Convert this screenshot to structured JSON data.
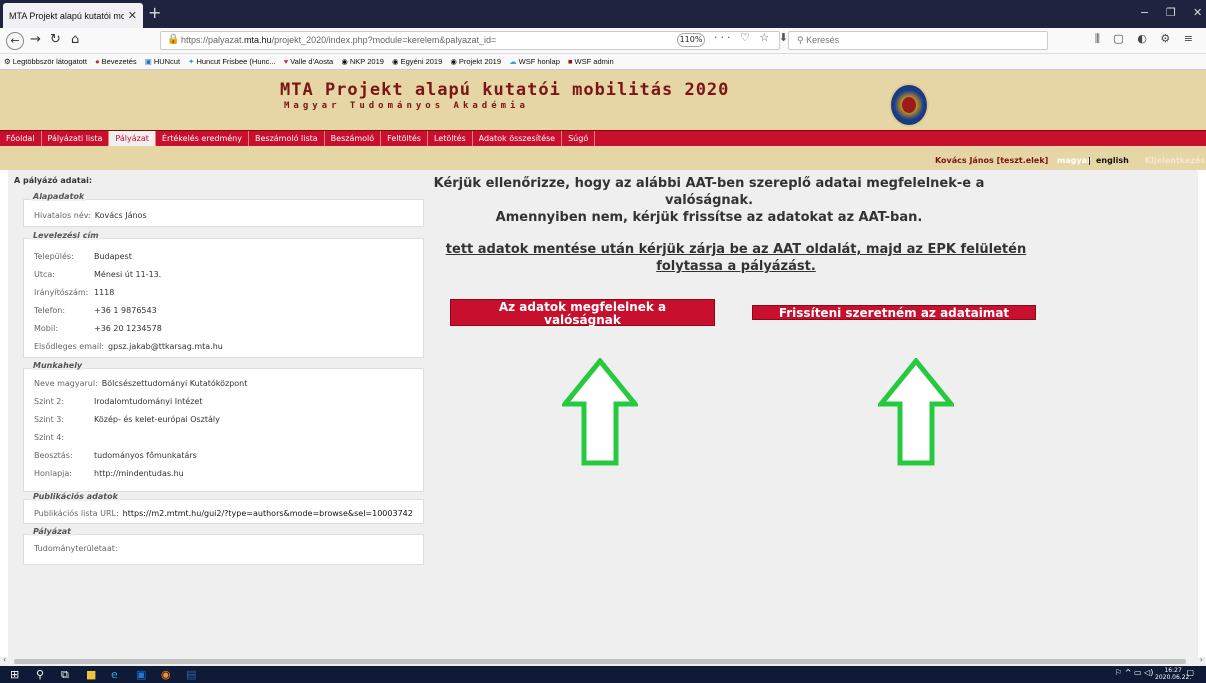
{
  "browser": {
    "tab_title": "MTA Projekt alapú kutatói mobilitá",
    "tab_close": "✕",
    "new_tab": "+",
    "url_prefix": "https://palyazat.",
    "url_domain": "mta.hu",
    "url_rest": "/projekt_2020/index.php?module=kerelem&palyazat_id=",
    "zoom": "110%",
    "search_placeholder": "Keresés",
    "window_minimize": "−",
    "window_restore": "❐",
    "window_close": "✕"
  },
  "bookmarks": [
    {
      "icon": "⚙",
      "label": "Legtöbbször látogatott"
    },
    {
      "icon": "●",
      "label": "Bevezetés"
    },
    {
      "icon": "▣",
      "label": "HUNcut"
    },
    {
      "icon": "✦",
      "label": "Huncut Frisbee (Hunc..."
    },
    {
      "icon": "♥",
      "label": "Valle d'Aosta"
    },
    {
      "icon": "◉",
      "label": "NKP 2019"
    },
    {
      "icon": "◉",
      "label": "Egyéni 2019"
    },
    {
      "icon": "◉",
      "label": "Projekt 2019"
    },
    {
      "icon": "☁",
      "label": "WSF honlap"
    },
    {
      "icon": "■",
      "label": "WSF admin"
    }
  ],
  "site": {
    "title": "MTA Projekt alapú kutatói mobilitás 2020",
    "subtitle": "Magyar Tudományos Akadémia",
    "menu": [
      "Főoldal",
      "Pályázati lista",
      "Pályázat",
      "Értékelés eredmény",
      "Beszámoló lista",
      "Beszámoló",
      "Feltöltés",
      "Letöltés",
      "Adatok összesítése",
      "Súgó"
    ],
    "active_menu_index": 2,
    "user": "Kovács János [teszt.elek]",
    "lang_hu": "magyar",
    "lang_sep": "|",
    "lang_en": "english",
    "logout": "Kijelentkezés"
  },
  "applicant": {
    "heading": "A pályázó adatai:",
    "basics": {
      "title": "Alapadatok",
      "name_label": "Hivatalos név:",
      "name_value": "Kovács János"
    },
    "address": {
      "title": "Levelezési cím",
      "rows": [
        {
          "k": "Település:",
          "v": "Budapest"
        },
        {
          "k": "Utca:",
          "v": "Ménesi út 11-13."
        },
        {
          "k": "Irányítószám:",
          "v": "1118"
        },
        {
          "k": "Telefon:",
          "v": "+36 1 9876543"
        },
        {
          "k": "Mobil:",
          "v": "+36 20 1234578"
        }
      ],
      "email_label": "Elsődleges email:",
      "email_value": "gpsz.jakab@ttkarsag.mta.hu"
    },
    "workplace": {
      "title": "Munkahely",
      "name_label": "Neve magyarul:",
      "name_value": "Bölcsészettudományi Kutatóközpont",
      "rows": [
        {
          "k": "Szint 2:",
          "v": "Irodalomtudományi Intézet"
        },
        {
          "k": "Szint 3:",
          "v": "Közép- és kelet-európai Osztály"
        },
        {
          "k": "Szint 4:",
          "v": ""
        },
        {
          "k": "Beosztás:",
          "v": "tudományos főmunkatárs"
        },
        {
          "k": "Honlapja:",
          "v": "http://mindentudas.hu"
        }
      ]
    },
    "publications": {
      "title": "Publikációs adatok",
      "label": "Publikációs lista URL:",
      "value": "https://m2.mtmt.hu/gui2/?type=authors&mode=browse&sel=10003742"
    },
    "application": {
      "title": "Pályázat",
      "label": "Tudományterületaat:"
    }
  },
  "main": {
    "message_line1": "Kérjük ellenőrizze, hogy az alábbi AAT-ben szereplő adatai megfelelnek-e a",
    "message_line2": "valóságnak.",
    "message_line3": "Amennyiben nem, kérjük frissítse az adatokat az AAT-ban.",
    "instruction_line1": "tett adatok mentése után kérjük zárja be az AAT oldalát, majd az EPK felületén",
    "instruction_line2": "folytassa a pályázást.",
    "btn_confirm_line1": "Az adatok megfelelnek a",
    "btn_confirm_line2": "valóságnak",
    "btn_update": "Frissíteni szeretném az adataimat"
  },
  "taskbar": {
    "clock_time": "16:27",
    "clock_date": "2020.06.22."
  },
  "colors": {
    "accent_red": "#c8102e",
    "header_tan": "#e6d6a6",
    "arrow_green": "#27c93f"
  }
}
